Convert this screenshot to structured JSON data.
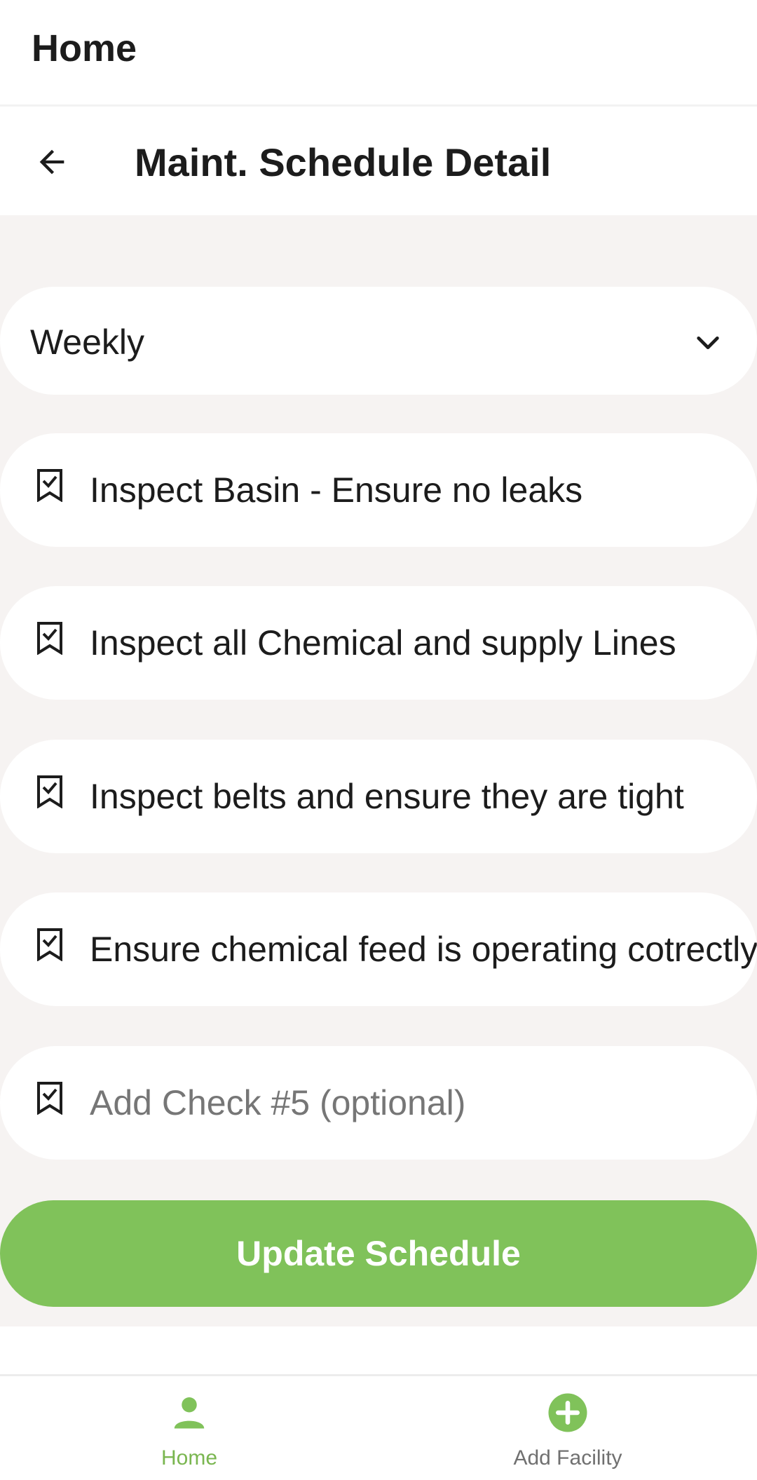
{
  "header": {
    "title": "Home"
  },
  "subheader": {
    "title": "Maint. Schedule Detail"
  },
  "frequency_select": {
    "value": "Weekly"
  },
  "checks": [
    {
      "text": "Inspect Basin - Ensure no leaks"
    },
    {
      "text": "Inspect all Chemical and supply Lines"
    },
    {
      "text": "Inspect belts and ensure they are tight"
    },
    {
      "text": "Ensure chemical feed is operating cotrectly"
    }
  ],
  "add_check": {
    "placeholder": "Add Check #5 (optional)"
  },
  "update_button": {
    "label": "Update Schedule"
  },
  "bottom_nav": {
    "items": [
      {
        "label": "Home",
        "icon": "person-icon",
        "active": true
      },
      {
        "label": "Add Facility",
        "icon": "add-circle-icon",
        "active": false
      }
    ]
  },
  "colors": {
    "accent": "#80c25a",
    "background": "#f6f3f2",
    "text": "#1c1c1c"
  }
}
